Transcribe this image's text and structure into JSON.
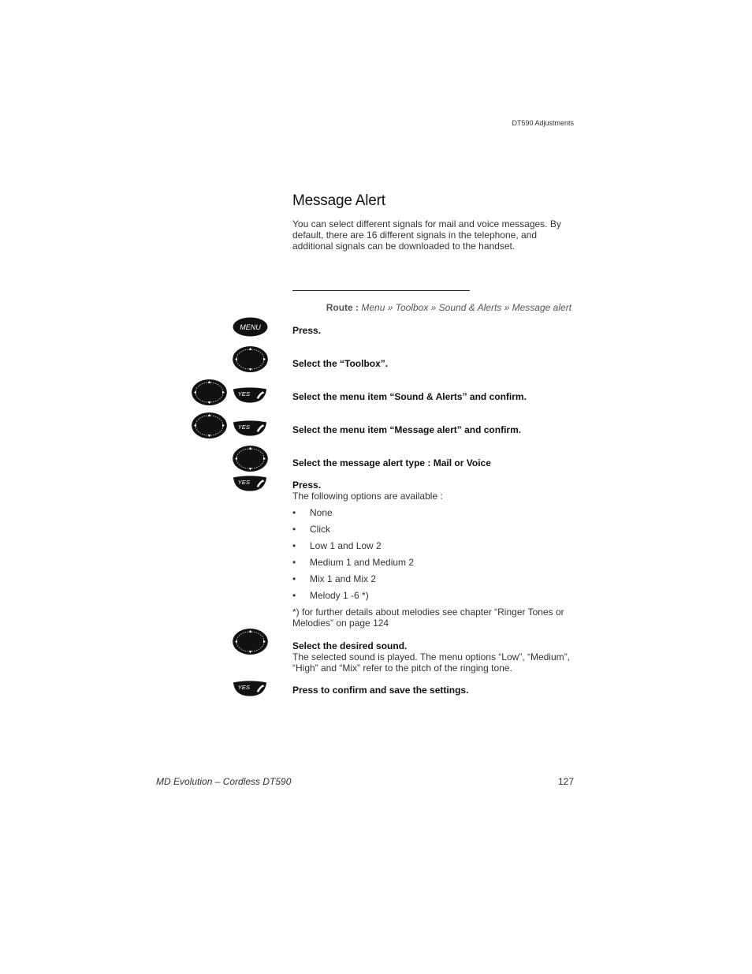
{
  "header": {
    "section": "DT590 Adjustments"
  },
  "title": "Message Alert",
  "intro": "You can select different signals for mail and voice messages. By default, there are 16 different signals in the telephone, and additional signals can be downloaded to the handset.",
  "route": {
    "label": "Route :",
    "path": "Menu » Toolbox » Sound & Alerts » Message alert"
  },
  "keys": {
    "menu_label": "MENU",
    "yes_label": "YES"
  },
  "steps": [
    {
      "instruction": "Press.",
      "keys": [
        "menu-key"
      ]
    },
    {
      "instruction": "Select the “Toolbox”.",
      "keys": [
        "navigation-key"
      ]
    },
    {
      "instruction": "Select the menu item “Sound & Alerts” and confirm.",
      "keys": [
        "navigation-key",
        "yes-key"
      ]
    },
    {
      "instruction": "Select the menu item “Message alert” and confirm.",
      "keys": [
        "navigation-key",
        "yes-key"
      ]
    },
    {
      "instruction": "Select the message alert type : Mail or Voice",
      "keys": [
        "navigation-key"
      ]
    },
    {
      "instruction": "Press.",
      "keys": [
        "yes-key"
      ],
      "detail": "The following options are available :",
      "options": [
        "None",
        "Click",
        "Low 1 and Low 2",
        "Medium 1 and Medium 2",
        "Mix 1 and Mix 2",
        "Melody 1 -6 *)"
      ],
      "footnote": "*) for further details about melodies see chapter “Ringer Tones or Melodies” on page 124"
    },
    {
      "instruction": "Select the desired sound.",
      "keys": [
        "navigation-key"
      ],
      "detail": "The selected sound is played. The menu options “Low”, “Medium”, “High” and “Mix” refer to the pitch of the ringing tone."
    },
    {
      "instruction": "Press to confirm and save the settings.",
      "keys": [
        "yes-key"
      ]
    }
  ],
  "footer": {
    "document": "MD Evolution – Cordless DT590",
    "page_number": "127"
  }
}
